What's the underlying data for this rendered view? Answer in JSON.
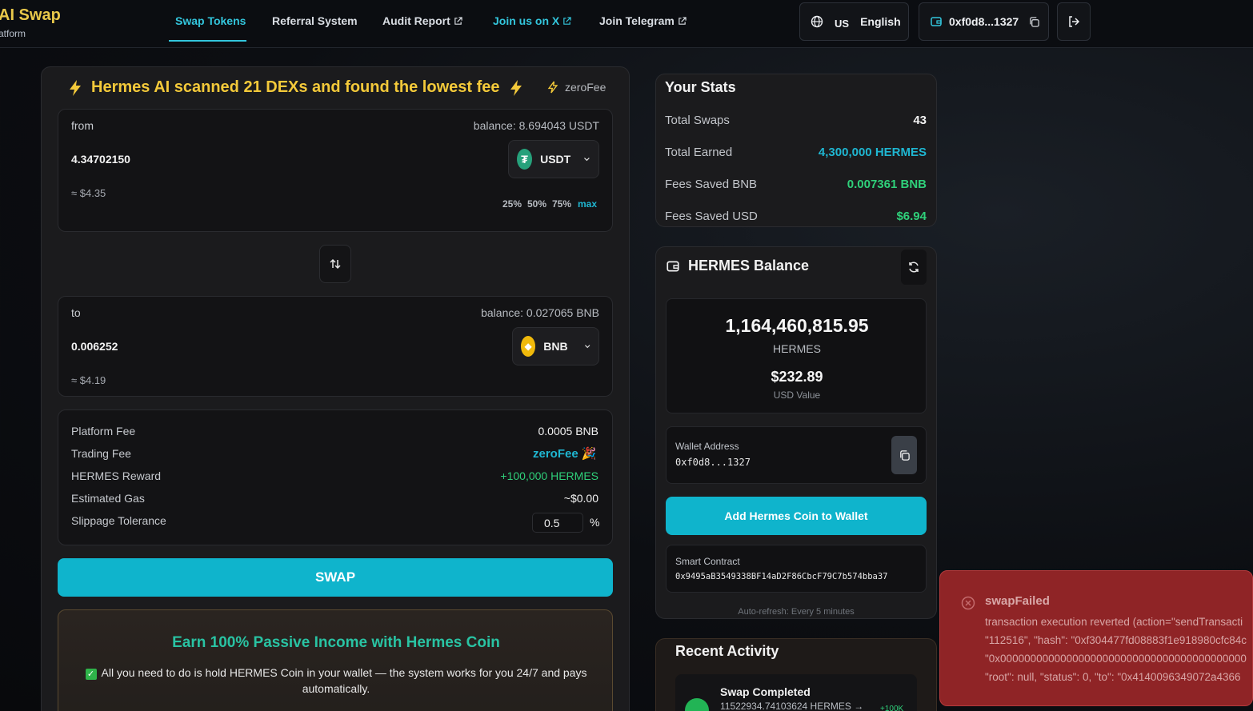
{
  "brand": {
    "title": "AI Swap",
    "subtitle": "atform"
  },
  "nav": {
    "items": [
      {
        "label": "Swap Tokens"
      },
      {
        "label": "Referral System"
      },
      {
        "label": "Audit Report"
      },
      {
        "label": "Join us on X"
      },
      {
        "label": "Join Telegram"
      }
    ],
    "lang_code": "US",
    "lang_label": "English",
    "wallet_short": "0xf0d8...1327"
  },
  "swap": {
    "headline": "Hermes AI scanned 21 DEXs and found the lowest fee",
    "zerofee_tag": "zeroFee",
    "from": {
      "label": "from",
      "balance": "balance: 8.694043 USDT",
      "amount": "4.34702150",
      "usd": "≈ $4.35",
      "token": "USDT",
      "percents": [
        "25%",
        "50%",
        "75%",
        "max"
      ]
    },
    "to": {
      "label": "to",
      "balance": "balance: 0.027065 BNB",
      "amount": "0.006252",
      "usd": "≈ $4.19",
      "token": "BNB"
    },
    "details": {
      "platform_fee_label": "Platform Fee",
      "platform_fee": "0.0005 BNB",
      "trading_fee_label": "Trading Fee",
      "trading_fee": "zeroFee",
      "reward_label": "HERMES Reward",
      "reward": "+100,000 HERMES",
      "gas_label": "Estimated Gas",
      "gas": "~$0.00",
      "slippage_label": "Slippage Tolerance",
      "slippage": "0.5",
      "slippage_unit": "%"
    },
    "swap_button": "SWAP"
  },
  "passive": {
    "title": "Earn 100% Passive Income with Hermes Coin",
    "text": "All you need to do is hold HERMES Coin in your wallet — the system works for you 24/7 and pays automatically."
  },
  "stats": {
    "title": "Your Stats",
    "rows": [
      {
        "label": "Total Swaps",
        "value": "43",
        "color": "#f2f2f2"
      },
      {
        "label": "Total Earned",
        "value": "4,300,000 HERMES",
        "color": "#1fb6d1"
      },
      {
        "label": "Fees Saved BNB",
        "value": "0.007361 BNB",
        "color": "#2fd07a"
      },
      {
        "label": "Fees Saved USD",
        "value": "$6.94",
        "color": "#2fd07a"
      }
    ]
  },
  "balance": {
    "title": "HERMES Balance",
    "amount": "1,164,460,815.95",
    "unit": "HERMES",
    "usd": "$232.89",
    "usd_label": "USD Value",
    "wallet_label": "Wallet Address",
    "wallet": "0xf0d8...1327",
    "add_button": "Add Hermes Coin to Wallet",
    "contract_label": "Smart Contract",
    "contract": "0x9495aB3549338BF14aD2F86CbcF79C7b574bba37",
    "auto_refresh": "Auto-refresh: Every 5 minutes"
  },
  "activity": {
    "title": "Recent Activity",
    "item_title": "Swap Completed",
    "item_sub": "11522934.74103624 HERMES →",
    "item_badge": "+100K"
  },
  "toast": {
    "title": "swapFailed",
    "lines": [
      "transaction execution reverted (action=\"sendTransacti",
      "\"112516\", \"hash\": \"0xf304477fd08883f1e918980cfc84c",
      "\"0x00000000000000000000000000000000000000000",
      "\"root\": null, \"status\": 0, \"to\": \"0x4140096349072a4366"
    ]
  }
}
